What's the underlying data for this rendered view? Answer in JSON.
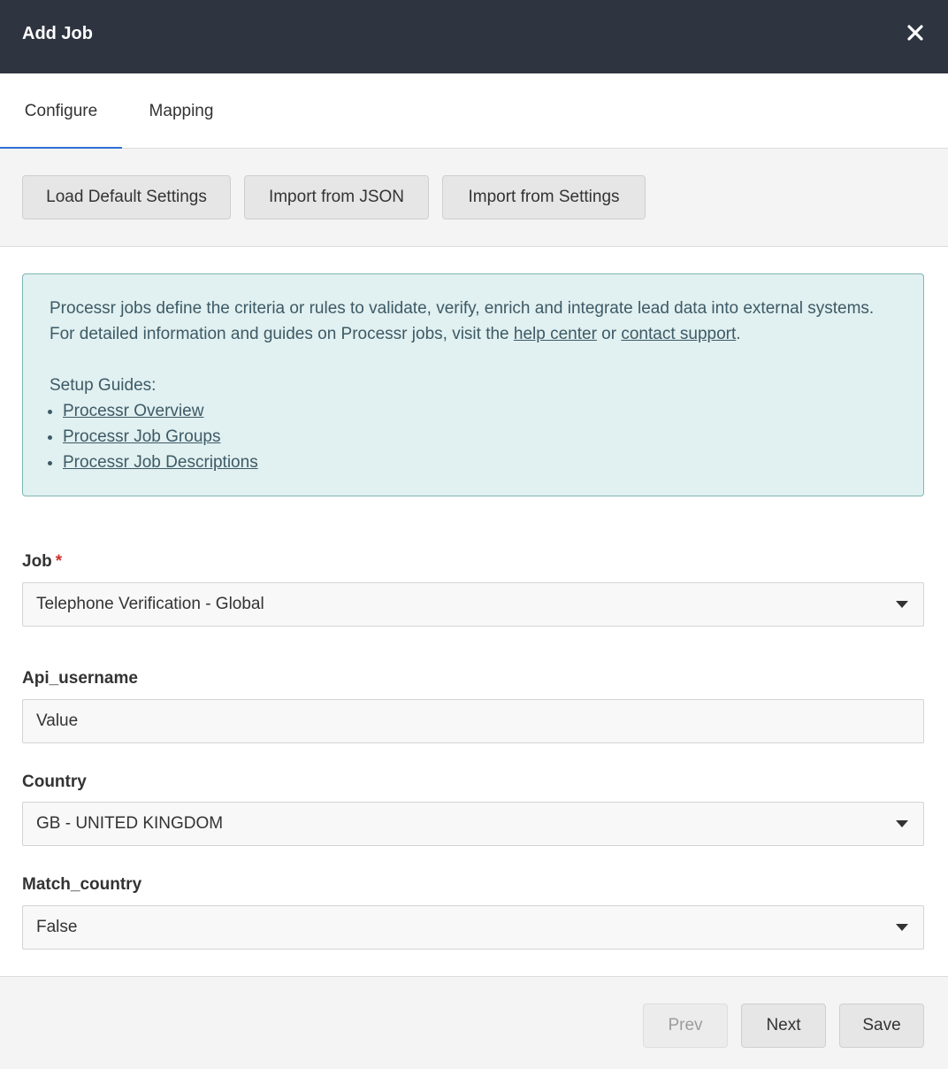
{
  "dialog": {
    "title": "Add Job",
    "close_icon": "close-icon"
  },
  "tabs": [
    {
      "label": "Configure",
      "active": true
    },
    {
      "label": "Mapping",
      "active": false
    }
  ],
  "toolbar": {
    "load_default": "Load Default Settings",
    "import_json": "Import from JSON",
    "import_settings": "Import from Settings"
  },
  "info": {
    "text_line1": "Processr jobs define the criteria or rules to validate, verify, enrich and integrate lead data into external systems.",
    "text_line2_prefix": "For detailed information and guides on Processr jobs, visit the ",
    "help_center": "help center",
    "or": " or ",
    "contact_support": "contact support",
    "period": ".",
    "setup_guides": "Setup Guides:",
    "guides": [
      "Processr Overview",
      "Processr Job Groups",
      "Processr Job Descriptions"
    ]
  },
  "form": {
    "job": {
      "label": "Job",
      "required_mark": "*",
      "value": "Telephone Verification - Global"
    },
    "api_username": {
      "label": "Api_username",
      "value": "Value"
    },
    "country": {
      "label": "Country",
      "value": "GB - UNITED KINGDOM"
    },
    "match_country": {
      "label": "Match_country",
      "value": "False"
    }
  },
  "footer": {
    "prev": "Prev",
    "next": "Next",
    "save": "Save"
  },
  "colors": {
    "header_bg": "#2e3440",
    "active_tab": "#2f6fd6",
    "info_bg": "#e1f0f0",
    "required": "#d32f2f"
  }
}
